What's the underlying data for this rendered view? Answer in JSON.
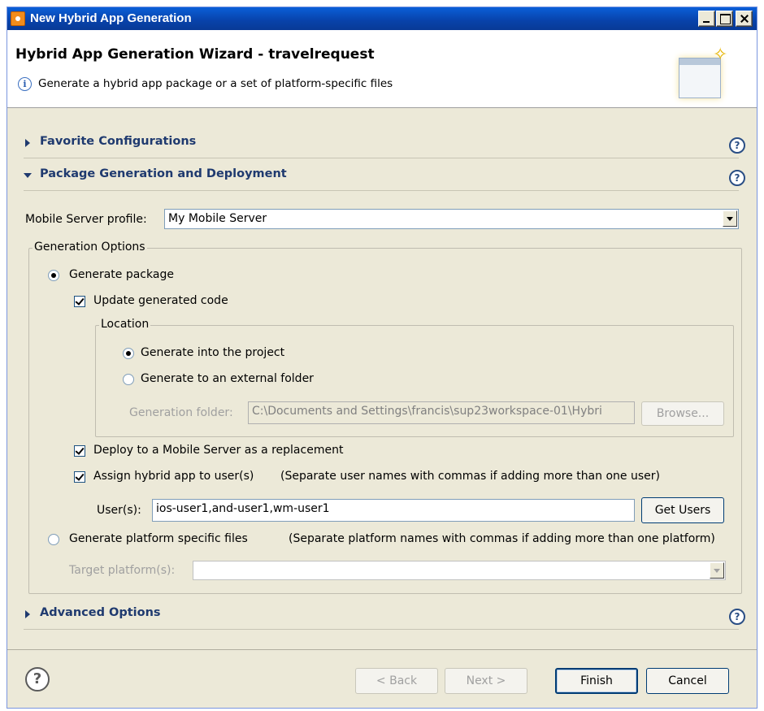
{
  "window": {
    "title": "New Hybrid App Generation"
  },
  "header": {
    "title": "Hybrid App Generation Wizard - travelrequest",
    "info": "Generate a hybrid app package or a set of platform-specific files"
  },
  "sections": {
    "favorites": "Favorite Configurations",
    "package": "Package Generation and Deployment",
    "advanced": "Advanced Options"
  },
  "form": {
    "profile_label": "Mobile Server profile:",
    "profile_value": "My Mobile Server",
    "generation_options_label": "Generation Options",
    "generate_package_label": "Generate package",
    "generate_package_selected": true,
    "update_code_label": "Update generated code",
    "update_code_checked": true,
    "location_label": "Location",
    "gen_into_project_label": "Generate into the project",
    "gen_into_project_selected": true,
    "gen_external_label": "Generate to an external folder",
    "gen_external_selected": false,
    "gen_folder_label": "Generation folder:",
    "gen_folder_value": "C:\\Documents and Settings\\francis\\sup23workspace-01\\Hybri",
    "browse_label": "Browse...",
    "deploy_label": "Deploy to a Mobile Server as a replacement",
    "deploy_checked": true,
    "assign_label": "Assign hybrid app to user(s)",
    "assign_hint": "(Separate user names with commas if adding more than one user)",
    "assign_checked": true,
    "users_label": "User(s):",
    "users_value": "ios-user1,and-user1,wm-user1",
    "get_users_label": "Get Users",
    "platform_files_label": "Generate platform specific files",
    "platform_files_hint": "(Separate platform names with commas if adding more than one platform)",
    "platform_files_selected": false,
    "target_platform_label": "Target platform(s):",
    "target_platform_value": ""
  },
  "footer": {
    "back": "< Back",
    "next": "Next >",
    "finish": "Finish",
    "cancel": "Cancel"
  },
  "icons": {
    "help": "?",
    "info": "i"
  }
}
